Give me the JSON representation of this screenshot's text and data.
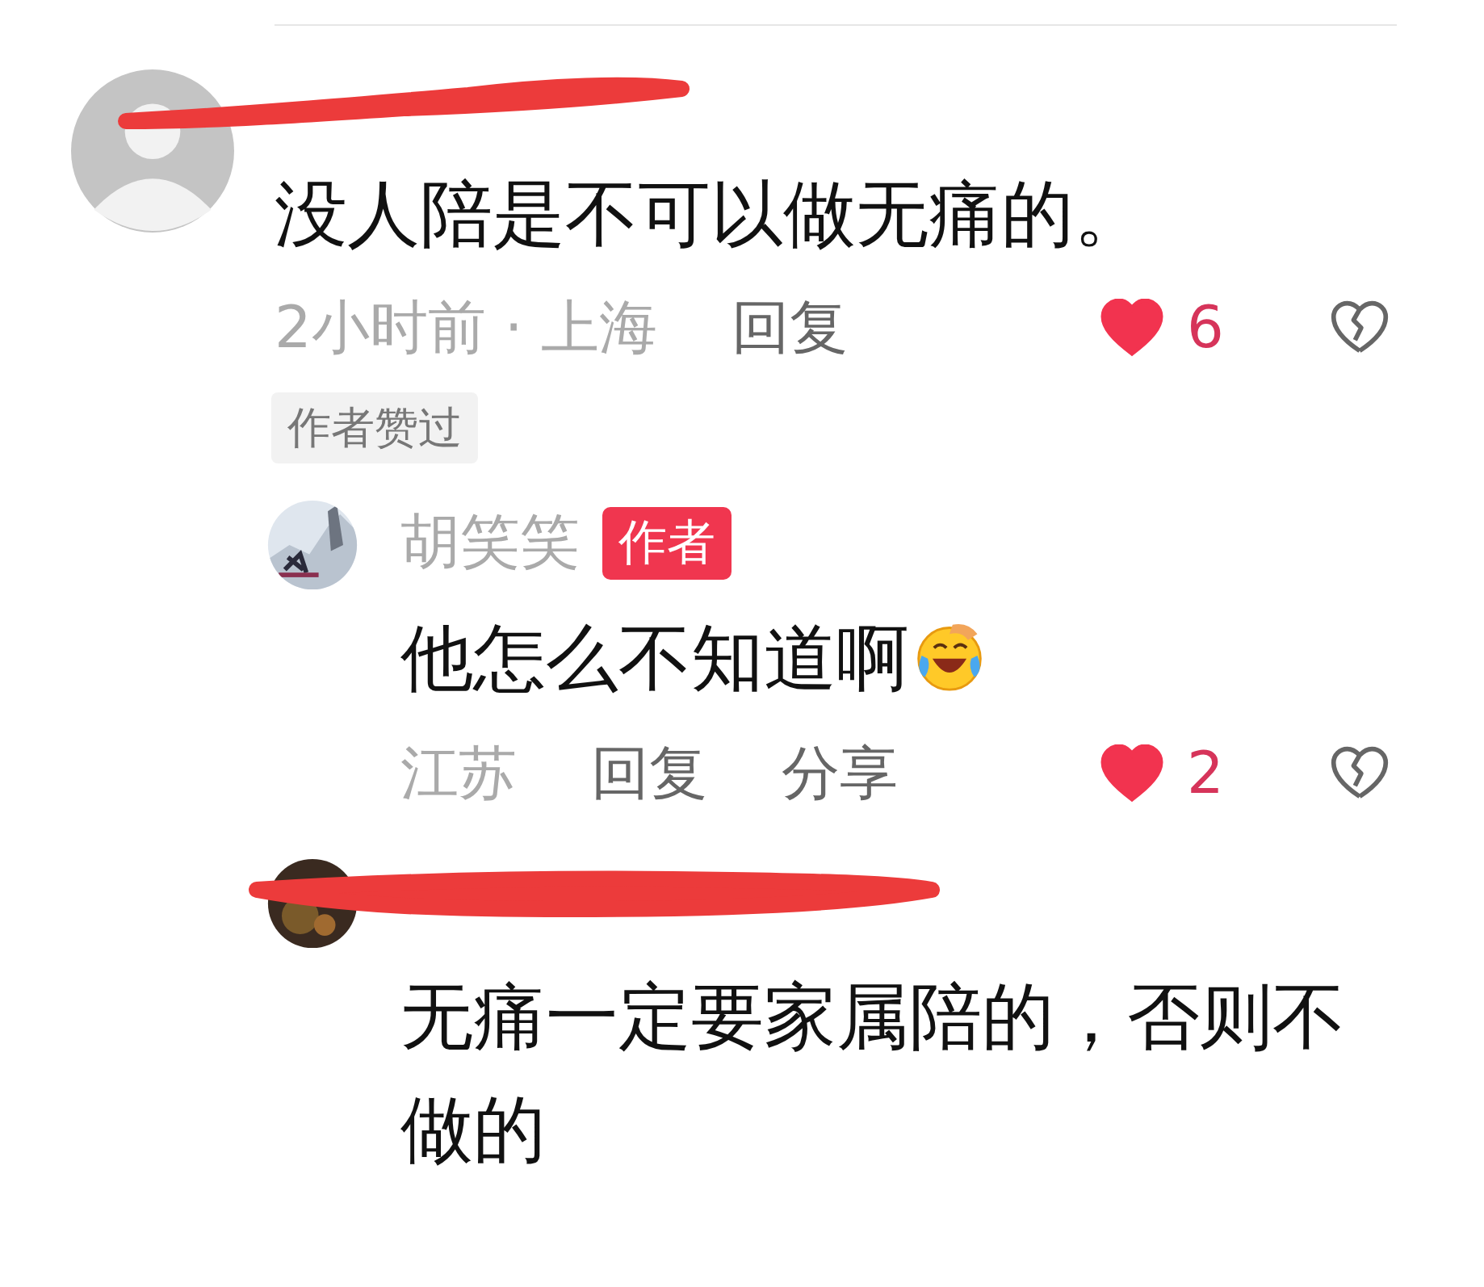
{
  "comments": [
    {
      "redacted": true,
      "body": "没人陪是不可以做无痛的。",
      "time_location": "2小时前 · 上海",
      "reply": "回复",
      "likes": "6",
      "liked": true,
      "badge": "作者赞过",
      "replies": [
        {
          "kind": "author",
          "name": "胡笑笑",
          "tag": "作者",
          "body": "他怎么不知道啊",
          "emoji": true,
          "location": "江苏",
          "reply": "回复",
          "share": "分享",
          "likes": "2",
          "liked": true
        },
        {
          "kind": "plain",
          "redacted": true,
          "body": "无痛一定要家属陪的，否则不做的"
        }
      ]
    }
  ]
}
